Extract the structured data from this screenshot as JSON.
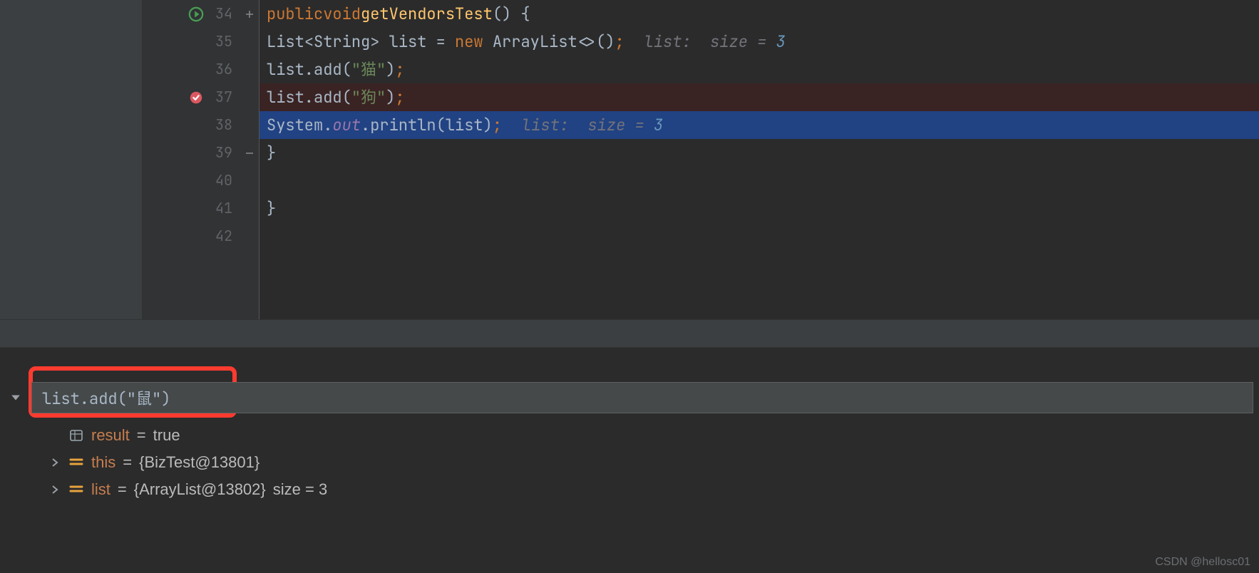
{
  "gutter": {
    "lines": [
      "34",
      "35",
      "36",
      "37",
      "38",
      "39",
      "40",
      "41",
      "42"
    ]
  },
  "code": {
    "l34": {
      "public": "public",
      "void": "void",
      "method": "getVendorsTest",
      "paren": "() {"
    },
    "l35": {
      "type1": "List",
      "lt": "<",
      "type2": "String",
      "gt": ">",
      "var": " list ",
      "eq": "=",
      "new": " new ",
      "type3": "ArrayList",
      "diamond": "<>()",
      "semi": ";",
      "hint_label": "list:",
      "hint_size": "size = ",
      "hint_val": "3"
    },
    "l36": {
      "call": "list.add",
      "open": "(",
      "str": "\"猫\"",
      "close": ")",
      "semi": ";"
    },
    "l37": {
      "call": "list.add",
      "open": "(",
      "str": "\"狗\"",
      "close": ")",
      "semi": ";"
    },
    "l38": {
      "sys": "System.",
      "out": "out",
      "println": ".println",
      "open": "(",
      "arg": "list",
      "close": ")",
      "semi": ";",
      "hint_label": "list:",
      "hint_size": "size = ",
      "hint_val": "3"
    },
    "l39": {
      "brace": "}"
    },
    "l41": {
      "brace": "}"
    }
  },
  "evaluate": {
    "value": "list.add(\"鼠\")"
  },
  "vars": {
    "r1": {
      "name": "result",
      "eq": " = ",
      "val": "true"
    },
    "r2": {
      "name": "this",
      "eq": " = ",
      "val": "{BizTest@13801}"
    },
    "r3": {
      "name": "list",
      "eq": " = ",
      "val": "{ArrayList@13802}",
      "extra": "  size = 3"
    }
  },
  "watermark": "CSDN @hellosc01"
}
